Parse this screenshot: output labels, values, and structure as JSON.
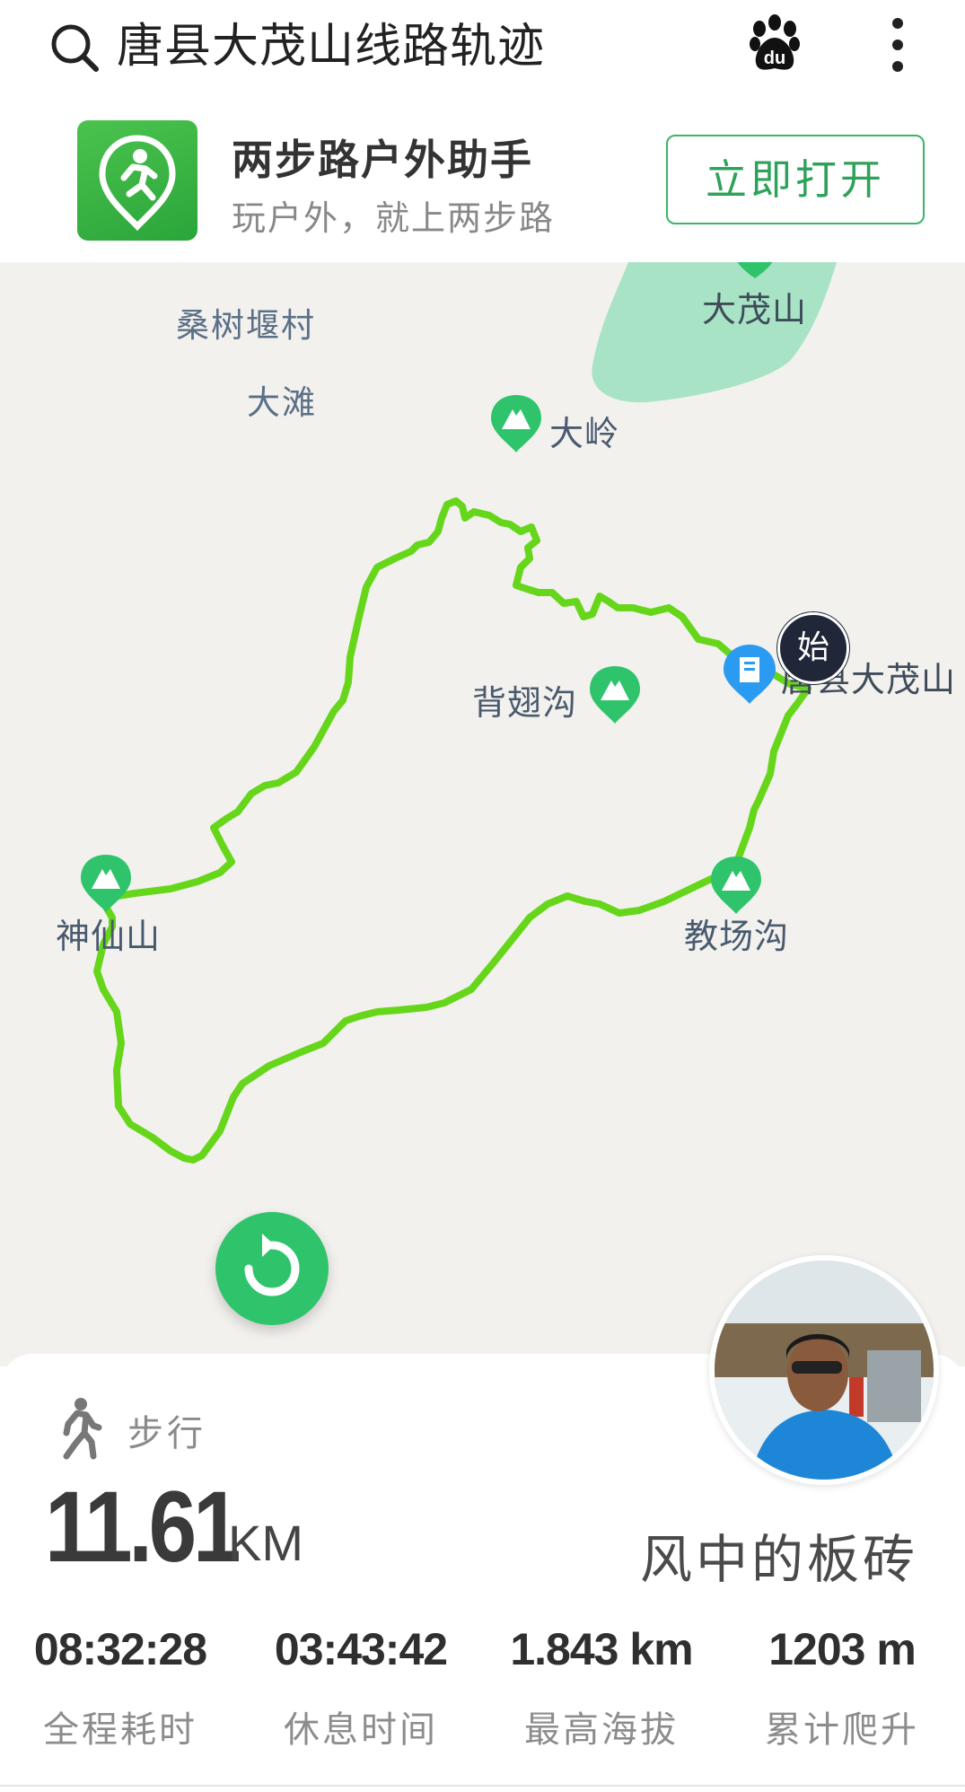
{
  "search": {
    "query": "唐县大茂山线路轨迹",
    "icons": [
      "search-icon",
      "baidu-paw-icon",
      "more-vertical-icon"
    ]
  },
  "banner": {
    "app_name": "两步路户外助手",
    "slogan": "玩户外，就上两步路",
    "open_label": "立即打开",
    "accent": "#2ea25a"
  },
  "map": {
    "places": [
      {
        "name": "桑树堰村"
      },
      {
        "name": "大滩"
      },
      {
        "name": "大茂山"
      }
    ],
    "pois": [
      {
        "name": "大岭"
      },
      {
        "name": "背翅沟"
      },
      {
        "name": "神仙山"
      },
      {
        "name": "教场沟"
      },
      {
        "name": "唐县大茂山"
      }
    ],
    "start_badge": "始",
    "track_color": "#66d61a",
    "poi_color": "#2fc46c"
  },
  "track": {
    "mode": "步行",
    "distance": "11.61",
    "distance_unit": "KM",
    "user": "风中的板砖",
    "stats": [
      {
        "value": "08:32:28",
        "label": "全程耗时"
      },
      {
        "value": "03:43:42",
        "label": "休息时间"
      },
      {
        "value": "1.843 km",
        "label": "最高海拔"
      },
      {
        "value": "1203 m",
        "label": "累计爬升"
      }
    ]
  }
}
